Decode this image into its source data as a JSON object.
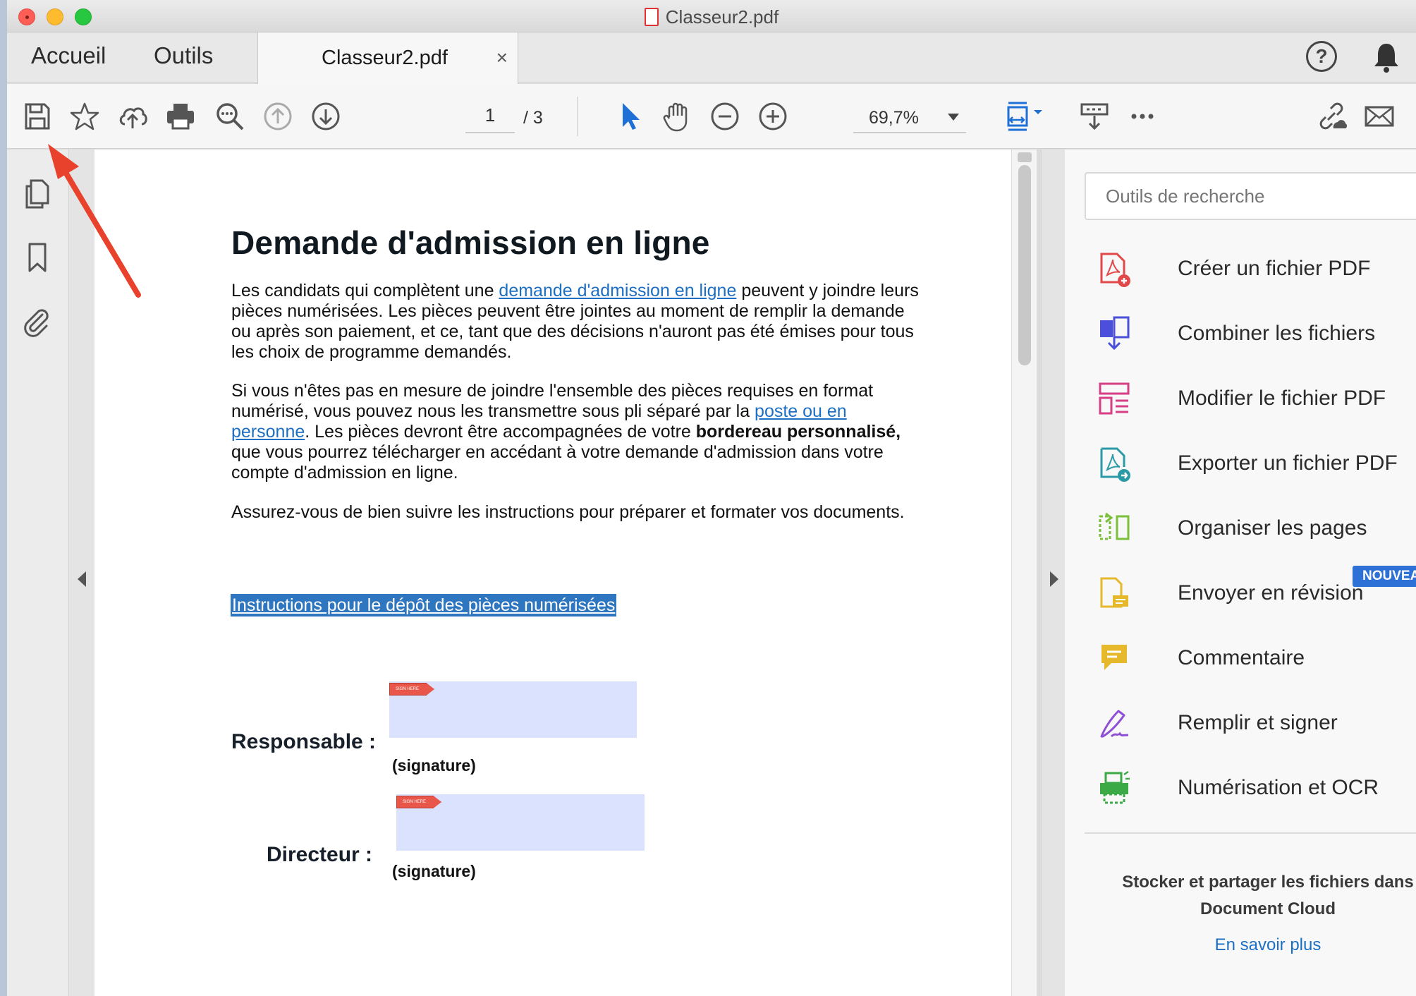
{
  "window": {
    "title": "Classeur2.pdf"
  },
  "tabs": {
    "home": "Accueil",
    "tools": "Outils",
    "document": "Classeur2.pdf",
    "close": "×"
  },
  "header_icons": {
    "help": "?"
  },
  "toolbar": {
    "icons": [
      "save-icon",
      "star-icon",
      "upload-cloud-icon",
      "print-icon",
      "search-zoom-icon",
      "page-up-icon",
      "page-down-icon"
    ],
    "page_current": "1",
    "page_total": "/ 3",
    "zoom": "69,7%"
  },
  "document": {
    "title": "Demande d'admission en ligne",
    "p1_before": "Les candidats qui complètent une ",
    "p1_link": "demande d'admission en ligne",
    "p1_after": " peuvent y joindre leurs pièces numérisées. Les pièces peuvent être jointes au moment de remplir la demande ou après son paiement, et ce, tant que des décisions n'auront pas été émises pour tous les choix de programme demandés.",
    "p2_before": "Si vous n'êtes pas en mesure de joindre l'ensemble des pièces requises en format numérisé, vous pouvez nous les transmettre sous pli séparé par la ",
    "p2_link": "poste ou en personne",
    "p2_middle": ". Les pièces devront être accompagnées de votre ",
    "p2_bold": "bordereau personnalisé,",
    "p2_after": " que vous pourrez télécharger en accédant à votre demande d'admission dans votre compte d'admission en ligne.",
    "p3": "Assurez-vous de bien suivre les instructions pour préparer et formater vos documents.",
    "instructions_link": "Instructions pour le dépôt des pièces numérisées",
    "responsable_label": "Responsable :",
    "directeur_label": "Directeur :",
    "signature_caption": "(signature)",
    "sign_tag": "SIGN HERE"
  },
  "tools_pane": {
    "search_placeholder": "Outils de recherche",
    "items": [
      {
        "label": "Créer un fichier PDF",
        "icon": "create-pdf-icon",
        "color": "#e0484a"
      },
      {
        "label": "Combiner les fichiers",
        "icon": "combine-files-icon",
        "color": "#4b4fd9"
      },
      {
        "label": "Modifier le fichier PDF",
        "icon": "edit-pdf-icon",
        "color": "#d63e86"
      },
      {
        "label": "Exporter un fichier PDF",
        "icon": "export-pdf-icon",
        "color": "#2a9aa6"
      },
      {
        "label": "Organiser les pages",
        "icon": "organize-pages-icon",
        "color": "#7bbf3a"
      },
      {
        "label": "Envoyer en révision",
        "icon": "send-review-icon",
        "color": "#e6b82b"
      },
      {
        "label": "Commentaire",
        "icon": "comment-icon",
        "color": "#e6b82b"
      },
      {
        "label": "Remplir et signer",
        "icon": "fill-sign-icon",
        "color": "#8e4fd6"
      },
      {
        "label": "Numérisation et OCR",
        "icon": "scan-ocr-icon",
        "color": "#3aa946"
      }
    ],
    "new_badge": "NOUVEA",
    "cloud_line1": "Stocker et partager les fichiers dans",
    "cloud_line2": "Document Cloud",
    "learn_more": "En savoir plus"
  },
  "colors": {
    "accent": "#1d6fc4",
    "highlight": "#2e76c0",
    "signature_field": "#dbe2fd",
    "annotation_arrow": "#e8412c"
  }
}
